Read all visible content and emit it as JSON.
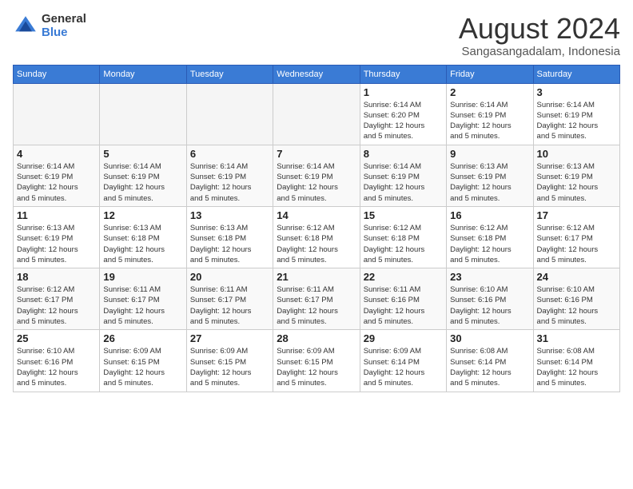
{
  "logo": {
    "general": "General",
    "blue": "Blue"
  },
  "title": {
    "month_year": "August 2024",
    "location": "Sangasangadalam, Indonesia"
  },
  "weekdays": [
    "Sunday",
    "Monday",
    "Tuesday",
    "Wednesday",
    "Thursday",
    "Friday",
    "Saturday"
  ],
  "weeks": [
    [
      {
        "day": "",
        "detail": ""
      },
      {
        "day": "",
        "detail": ""
      },
      {
        "day": "",
        "detail": ""
      },
      {
        "day": "",
        "detail": ""
      },
      {
        "day": "1",
        "detail": "Sunrise: 6:14 AM\nSunset: 6:20 PM\nDaylight: 12 hours\nand 5 minutes."
      },
      {
        "day": "2",
        "detail": "Sunrise: 6:14 AM\nSunset: 6:19 PM\nDaylight: 12 hours\nand 5 minutes."
      },
      {
        "day": "3",
        "detail": "Sunrise: 6:14 AM\nSunset: 6:19 PM\nDaylight: 12 hours\nand 5 minutes."
      }
    ],
    [
      {
        "day": "4",
        "detail": "Sunrise: 6:14 AM\nSunset: 6:19 PM\nDaylight: 12 hours\nand 5 minutes."
      },
      {
        "day": "5",
        "detail": "Sunrise: 6:14 AM\nSunset: 6:19 PM\nDaylight: 12 hours\nand 5 minutes."
      },
      {
        "day": "6",
        "detail": "Sunrise: 6:14 AM\nSunset: 6:19 PM\nDaylight: 12 hours\nand 5 minutes."
      },
      {
        "day": "7",
        "detail": "Sunrise: 6:14 AM\nSunset: 6:19 PM\nDaylight: 12 hours\nand 5 minutes."
      },
      {
        "day": "8",
        "detail": "Sunrise: 6:14 AM\nSunset: 6:19 PM\nDaylight: 12 hours\nand 5 minutes."
      },
      {
        "day": "9",
        "detail": "Sunrise: 6:13 AM\nSunset: 6:19 PM\nDaylight: 12 hours\nand 5 minutes."
      },
      {
        "day": "10",
        "detail": "Sunrise: 6:13 AM\nSunset: 6:19 PM\nDaylight: 12 hours\nand 5 minutes."
      }
    ],
    [
      {
        "day": "11",
        "detail": "Sunrise: 6:13 AM\nSunset: 6:19 PM\nDaylight: 12 hours\nand 5 minutes."
      },
      {
        "day": "12",
        "detail": "Sunrise: 6:13 AM\nSunset: 6:18 PM\nDaylight: 12 hours\nand 5 minutes."
      },
      {
        "day": "13",
        "detail": "Sunrise: 6:13 AM\nSunset: 6:18 PM\nDaylight: 12 hours\nand 5 minutes."
      },
      {
        "day": "14",
        "detail": "Sunrise: 6:12 AM\nSunset: 6:18 PM\nDaylight: 12 hours\nand 5 minutes."
      },
      {
        "day": "15",
        "detail": "Sunrise: 6:12 AM\nSunset: 6:18 PM\nDaylight: 12 hours\nand 5 minutes."
      },
      {
        "day": "16",
        "detail": "Sunrise: 6:12 AM\nSunset: 6:18 PM\nDaylight: 12 hours\nand 5 minutes."
      },
      {
        "day": "17",
        "detail": "Sunrise: 6:12 AM\nSunset: 6:17 PM\nDaylight: 12 hours\nand 5 minutes."
      }
    ],
    [
      {
        "day": "18",
        "detail": "Sunrise: 6:12 AM\nSunset: 6:17 PM\nDaylight: 12 hours\nand 5 minutes."
      },
      {
        "day": "19",
        "detail": "Sunrise: 6:11 AM\nSunset: 6:17 PM\nDaylight: 12 hours\nand 5 minutes."
      },
      {
        "day": "20",
        "detail": "Sunrise: 6:11 AM\nSunset: 6:17 PM\nDaylight: 12 hours\nand 5 minutes."
      },
      {
        "day": "21",
        "detail": "Sunrise: 6:11 AM\nSunset: 6:17 PM\nDaylight: 12 hours\nand 5 minutes."
      },
      {
        "day": "22",
        "detail": "Sunrise: 6:11 AM\nSunset: 6:16 PM\nDaylight: 12 hours\nand 5 minutes."
      },
      {
        "day": "23",
        "detail": "Sunrise: 6:10 AM\nSunset: 6:16 PM\nDaylight: 12 hours\nand 5 minutes."
      },
      {
        "day": "24",
        "detail": "Sunrise: 6:10 AM\nSunset: 6:16 PM\nDaylight: 12 hours\nand 5 minutes."
      }
    ],
    [
      {
        "day": "25",
        "detail": "Sunrise: 6:10 AM\nSunset: 6:16 PM\nDaylight: 12 hours\nand 5 minutes."
      },
      {
        "day": "26",
        "detail": "Sunrise: 6:09 AM\nSunset: 6:15 PM\nDaylight: 12 hours\nand 5 minutes."
      },
      {
        "day": "27",
        "detail": "Sunrise: 6:09 AM\nSunset: 6:15 PM\nDaylight: 12 hours\nand 5 minutes."
      },
      {
        "day": "28",
        "detail": "Sunrise: 6:09 AM\nSunset: 6:15 PM\nDaylight: 12 hours\nand 5 minutes."
      },
      {
        "day": "29",
        "detail": "Sunrise: 6:09 AM\nSunset: 6:14 PM\nDaylight: 12 hours\nand 5 minutes."
      },
      {
        "day": "30",
        "detail": "Sunrise: 6:08 AM\nSunset: 6:14 PM\nDaylight: 12 hours\nand 5 minutes."
      },
      {
        "day": "31",
        "detail": "Sunrise: 6:08 AM\nSunset: 6:14 PM\nDaylight: 12 hours\nand 5 minutes."
      }
    ]
  ]
}
